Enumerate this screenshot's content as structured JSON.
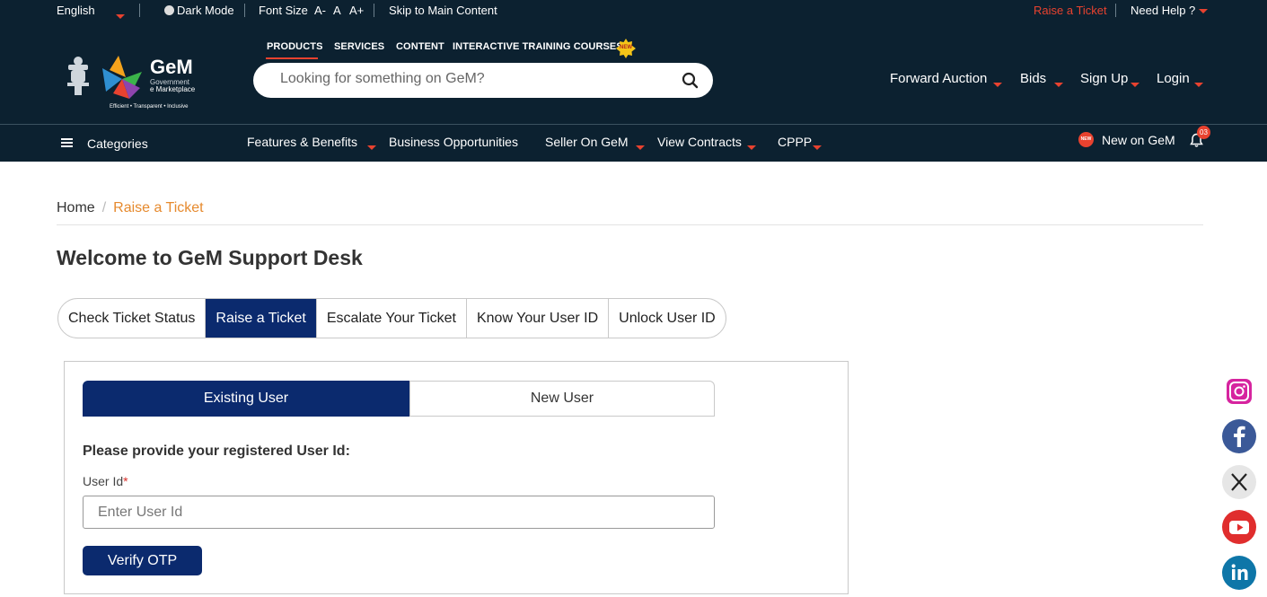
{
  "topbar": {
    "language": "English",
    "dark_mode": "Dark Mode",
    "font_size": "Font Size",
    "font_decrease": "A-",
    "font_normal": "A",
    "font_increase": "A+",
    "skip": "Skip to Main Content",
    "raise_ticket": "Raise a Ticket",
    "need_help": "Need Help ?"
  },
  "logo": {
    "name": "GeM",
    "line1": "Government",
    "line2": "e Marketplace",
    "tagline": "Efficient • Transparent • Inclusive"
  },
  "product_tabs": [
    "PRODUCTS",
    "SERVICES",
    "CONTENT",
    "INTERACTIVE TRAINING COURSES"
  ],
  "new_label": "NEW",
  "search": {
    "placeholder": "Looking for something on GeM?"
  },
  "right_nav": [
    "Forward Auction",
    "Bids",
    "Sign Up",
    "Login"
  ],
  "navbar": {
    "categories": "Categories",
    "items": [
      "Features & Benefits",
      "Business Opportunities",
      "Seller On GeM",
      "View Contracts",
      "CPPP"
    ],
    "new_on_gem": "New on GeM",
    "notifications": "03"
  },
  "breadcrumb": {
    "home": "Home",
    "separator": "/",
    "current": "Raise a Ticket"
  },
  "page_title": "Welcome to GeM Support Desk",
  "tabs": [
    "Check Ticket Status",
    "Raise a Ticket",
    "Escalate Your Ticket",
    "Know Your User ID",
    "Unlock User ID"
  ],
  "active_tab": "Raise a Ticket",
  "user_tabs": {
    "existing": "Existing User",
    "new": "New User"
  },
  "form": {
    "prompt": "Please provide your registered User Id:",
    "label": "User Id",
    "required": "*",
    "placeholder": "Enter User Id",
    "value": "",
    "button": "Verify OTP"
  },
  "social": [
    "instagram-icon",
    "facebook-icon",
    "x-icon",
    "youtube-icon",
    "linkedin-icon"
  ],
  "colors": {
    "header_bg": "#0c2130",
    "accent_red": "#e8422f",
    "primary_blue": "#0b2a6e",
    "breadcrumb_orange": "#e68a2e"
  }
}
